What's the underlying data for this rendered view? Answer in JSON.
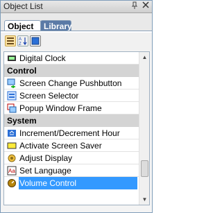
{
  "panel": {
    "title": "Object List",
    "pin_glyph": "📌",
    "close_glyph": "✕"
  },
  "tabs": [
    {
      "label": "Object",
      "active": true
    },
    {
      "label": "Library",
      "active": false
    }
  ],
  "toolbar": [
    {
      "name": "categorized-view-icon",
      "selected": true
    },
    {
      "name": "sort-az-icon",
      "selected": false
    },
    {
      "name": "large-icon-view-icon",
      "selected": false
    }
  ],
  "list": [
    {
      "type": "item",
      "label": "Digital Clock",
      "icon": "digital-clock-icon"
    },
    {
      "type": "header",
      "label": "Control"
    },
    {
      "type": "item",
      "label": "Screen Change Pushbutton",
      "icon": "screen-change-icon"
    },
    {
      "type": "item",
      "label": "Screen Selector",
      "icon": "screen-selector-icon"
    },
    {
      "type": "item",
      "label": "Popup Window Frame",
      "icon": "popup-window-icon"
    },
    {
      "type": "header",
      "label": "System"
    },
    {
      "type": "item",
      "label": "Increment/Decrement Hour",
      "icon": "increment-hour-icon"
    },
    {
      "type": "item",
      "label": "Activate Screen Saver",
      "icon": "screen-saver-icon"
    },
    {
      "type": "item",
      "label": "Adjust Display",
      "icon": "adjust-display-icon"
    },
    {
      "type": "item",
      "label": "Set Language",
      "icon": "language-icon"
    },
    {
      "type": "item",
      "label": "Volume Control",
      "icon": "volume-control-icon",
      "selected": true
    }
  ],
  "scrollbar": {
    "position": 0.85
  },
  "colors": {
    "selection": "#3399ff",
    "header_bg": "#d4d4d4",
    "tab_inactive": "#5a7aa6"
  }
}
